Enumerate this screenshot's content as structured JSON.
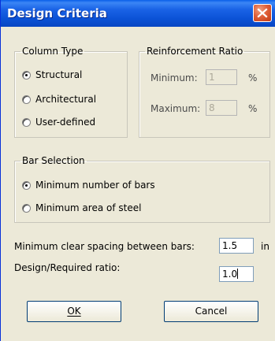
{
  "window": {
    "title": "Design Criteria"
  },
  "column_type": {
    "legend": "Column Type",
    "options": [
      "Structural",
      "Architectural",
      "User-defined"
    ],
    "selected": "Structural"
  },
  "reinforcement_ratio": {
    "legend": "Reinforcement Ratio",
    "minimum_label": "Minimum:",
    "minimum_value": "1",
    "maximum_label": "Maximum:",
    "maximum_value": "8",
    "unit": "%"
  },
  "bar_selection": {
    "legend": "Bar Selection",
    "options": [
      "Minimum number of bars",
      "Minimum area of steel"
    ],
    "selected": "Minimum number of bars"
  },
  "spacing": {
    "label": "Minimum clear spacing between bars:",
    "value": "1.5",
    "unit": "in"
  },
  "ratio": {
    "label": "Design/Required ratio:",
    "value": "1.0"
  },
  "buttons": {
    "ok": "OK",
    "cancel": "Cancel"
  },
  "colors": {
    "title_bar": "#0b52d6",
    "dialog_bg": "#ece9d8",
    "close_button": "#e0603a"
  },
  "icons": {
    "close": "close-icon"
  }
}
